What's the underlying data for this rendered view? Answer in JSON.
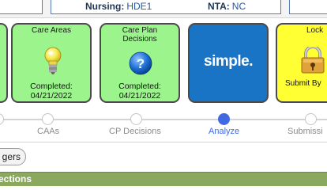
{
  "header": {
    "nursing_label": "Nursing:",
    "nursing_value": "HDE1",
    "nta_label": "NTA:",
    "nta_value": "NC"
  },
  "tiles": [
    {
      "title": "Care Areas",
      "icon": "lightbulb-icon",
      "completed_label": "Completed:",
      "date": "04/21/2022",
      "color": "#9cf58c"
    },
    {
      "title_line1": "Care Plan",
      "title_line2": "Decisions",
      "icon": "question-icon",
      "completed_label": "Completed:",
      "date": "04/21/2022",
      "color": "#9cf58c"
    },
    {
      "logo_text": "simple.",
      "color": "#1a74c5"
    },
    {
      "title": "Lock",
      "icon": "padlock-icon",
      "subtitle": "Submit By",
      "color": "#ffff33"
    }
  ],
  "stepper": {
    "steps": [
      {
        "label": "CAAs",
        "active": false
      },
      {
        "label": "CP Decisions",
        "active": false
      },
      {
        "label": "Analyze",
        "active": true
      },
      {
        "label": "Submissi",
        "active": false
      }
    ],
    "active_color": "#4169e1"
  },
  "pill_button_label": "gers",
  "section_title": "ections"
}
